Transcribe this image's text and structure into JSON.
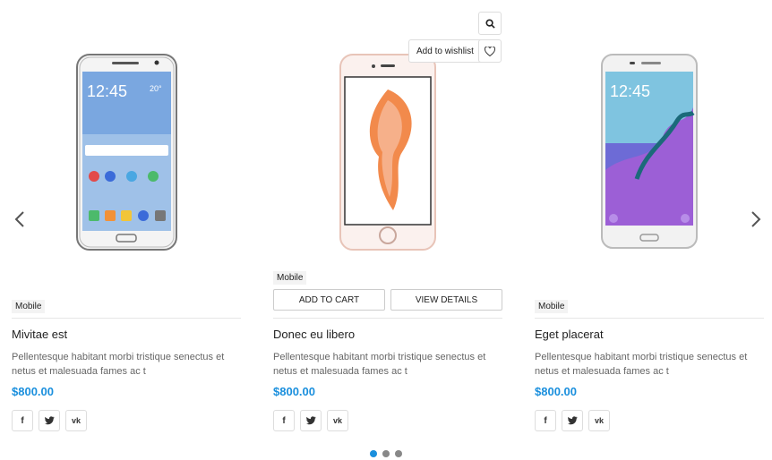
{
  "products": [
    {
      "category": "Mobile",
      "title": "Mivitae est",
      "description": "Pellentesque habitant morbi tristique senectus et netus et malesuada fames ac t",
      "price": "$800.00",
      "image": "samsung-galaxy-j7-phone"
    },
    {
      "category": "Mobile",
      "title": "Donec eu libero",
      "description": "Pellentesque habitant morbi tristique senectus et netus et malesuada fames ac t",
      "price": "$800.00",
      "image": "iphone-6s-rose-gold-phone",
      "add_to_cart_label": "ADD TO CART",
      "view_details_label": "VIEW DETAILS",
      "wishlist_label": "Add to wishlist"
    },
    {
      "category": "Mobile",
      "title": "Eget placerat",
      "description": "Pellentesque habitant morbi tristique senectus et netus et malesuada fames ac t",
      "price": "$800.00",
      "image": "samsung-galaxy-a7-phone"
    }
  ],
  "social": {
    "facebook": "f",
    "twitter": "twitter",
    "vk": "vk"
  },
  "carousel": {
    "pages": 3,
    "active_page": 1
  },
  "colors": {
    "accent": "#1a8fdd",
    "border": "#dddddd"
  }
}
